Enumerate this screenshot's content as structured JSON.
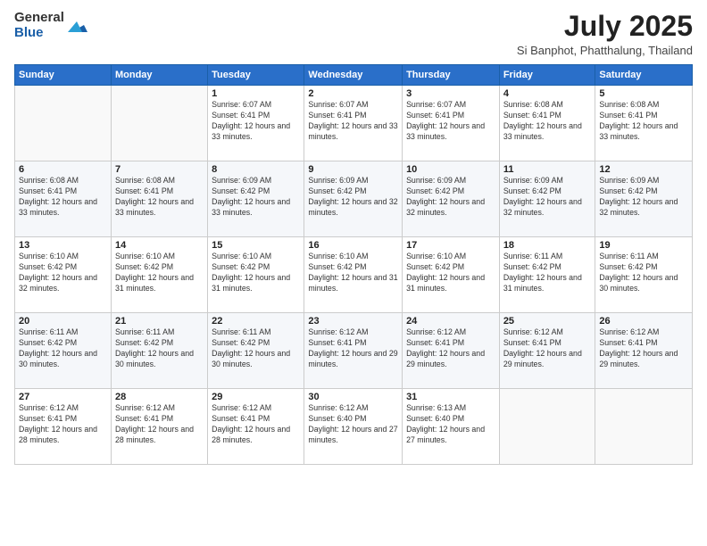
{
  "logo": {
    "general": "General",
    "blue": "Blue"
  },
  "header": {
    "title": "July 2025",
    "subtitle": "Si Banphot, Phatthalung, Thailand"
  },
  "weekdays": [
    "Sunday",
    "Monday",
    "Tuesday",
    "Wednesday",
    "Thursday",
    "Friday",
    "Saturday"
  ],
  "weeks": [
    [
      {
        "day": "",
        "info": ""
      },
      {
        "day": "",
        "info": ""
      },
      {
        "day": "1",
        "info": "Sunrise: 6:07 AM\nSunset: 6:41 PM\nDaylight: 12 hours and 33 minutes."
      },
      {
        "day": "2",
        "info": "Sunrise: 6:07 AM\nSunset: 6:41 PM\nDaylight: 12 hours and 33 minutes."
      },
      {
        "day": "3",
        "info": "Sunrise: 6:07 AM\nSunset: 6:41 PM\nDaylight: 12 hours and 33 minutes."
      },
      {
        "day": "4",
        "info": "Sunrise: 6:08 AM\nSunset: 6:41 PM\nDaylight: 12 hours and 33 minutes."
      },
      {
        "day": "5",
        "info": "Sunrise: 6:08 AM\nSunset: 6:41 PM\nDaylight: 12 hours and 33 minutes."
      }
    ],
    [
      {
        "day": "6",
        "info": "Sunrise: 6:08 AM\nSunset: 6:41 PM\nDaylight: 12 hours and 33 minutes."
      },
      {
        "day": "7",
        "info": "Sunrise: 6:08 AM\nSunset: 6:41 PM\nDaylight: 12 hours and 33 minutes."
      },
      {
        "day": "8",
        "info": "Sunrise: 6:09 AM\nSunset: 6:42 PM\nDaylight: 12 hours and 33 minutes."
      },
      {
        "day": "9",
        "info": "Sunrise: 6:09 AM\nSunset: 6:42 PM\nDaylight: 12 hours and 32 minutes."
      },
      {
        "day": "10",
        "info": "Sunrise: 6:09 AM\nSunset: 6:42 PM\nDaylight: 12 hours and 32 minutes."
      },
      {
        "day": "11",
        "info": "Sunrise: 6:09 AM\nSunset: 6:42 PM\nDaylight: 12 hours and 32 minutes."
      },
      {
        "day": "12",
        "info": "Sunrise: 6:09 AM\nSunset: 6:42 PM\nDaylight: 12 hours and 32 minutes."
      }
    ],
    [
      {
        "day": "13",
        "info": "Sunrise: 6:10 AM\nSunset: 6:42 PM\nDaylight: 12 hours and 32 minutes."
      },
      {
        "day": "14",
        "info": "Sunrise: 6:10 AM\nSunset: 6:42 PM\nDaylight: 12 hours and 31 minutes."
      },
      {
        "day": "15",
        "info": "Sunrise: 6:10 AM\nSunset: 6:42 PM\nDaylight: 12 hours and 31 minutes."
      },
      {
        "day": "16",
        "info": "Sunrise: 6:10 AM\nSunset: 6:42 PM\nDaylight: 12 hours and 31 minutes."
      },
      {
        "day": "17",
        "info": "Sunrise: 6:10 AM\nSunset: 6:42 PM\nDaylight: 12 hours and 31 minutes."
      },
      {
        "day": "18",
        "info": "Sunrise: 6:11 AM\nSunset: 6:42 PM\nDaylight: 12 hours and 31 minutes."
      },
      {
        "day": "19",
        "info": "Sunrise: 6:11 AM\nSunset: 6:42 PM\nDaylight: 12 hours and 30 minutes."
      }
    ],
    [
      {
        "day": "20",
        "info": "Sunrise: 6:11 AM\nSunset: 6:42 PM\nDaylight: 12 hours and 30 minutes."
      },
      {
        "day": "21",
        "info": "Sunrise: 6:11 AM\nSunset: 6:42 PM\nDaylight: 12 hours and 30 minutes."
      },
      {
        "day": "22",
        "info": "Sunrise: 6:11 AM\nSunset: 6:42 PM\nDaylight: 12 hours and 30 minutes."
      },
      {
        "day": "23",
        "info": "Sunrise: 6:12 AM\nSunset: 6:41 PM\nDaylight: 12 hours and 29 minutes."
      },
      {
        "day": "24",
        "info": "Sunrise: 6:12 AM\nSunset: 6:41 PM\nDaylight: 12 hours and 29 minutes."
      },
      {
        "day": "25",
        "info": "Sunrise: 6:12 AM\nSunset: 6:41 PM\nDaylight: 12 hours and 29 minutes."
      },
      {
        "day": "26",
        "info": "Sunrise: 6:12 AM\nSunset: 6:41 PM\nDaylight: 12 hours and 29 minutes."
      }
    ],
    [
      {
        "day": "27",
        "info": "Sunrise: 6:12 AM\nSunset: 6:41 PM\nDaylight: 12 hours and 28 minutes."
      },
      {
        "day": "28",
        "info": "Sunrise: 6:12 AM\nSunset: 6:41 PM\nDaylight: 12 hours and 28 minutes."
      },
      {
        "day": "29",
        "info": "Sunrise: 6:12 AM\nSunset: 6:41 PM\nDaylight: 12 hours and 28 minutes."
      },
      {
        "day": "30",
        "info": "Sunrise: 6:12 AM\nSunset: 6:40 PM\nDaylight: 12 hours and 27 minutes."
      },
      {
        "day": "31",
        "info": "Sunrise: 6:13 AM\nSunset: 6:40 PM\nDaylight: 12 hours and 27 minutes."
      },
      {
        "day": "",
        "info": ""
      },
      {
        "day": "",
        "info": ""
      }
    ]
  ]
}
